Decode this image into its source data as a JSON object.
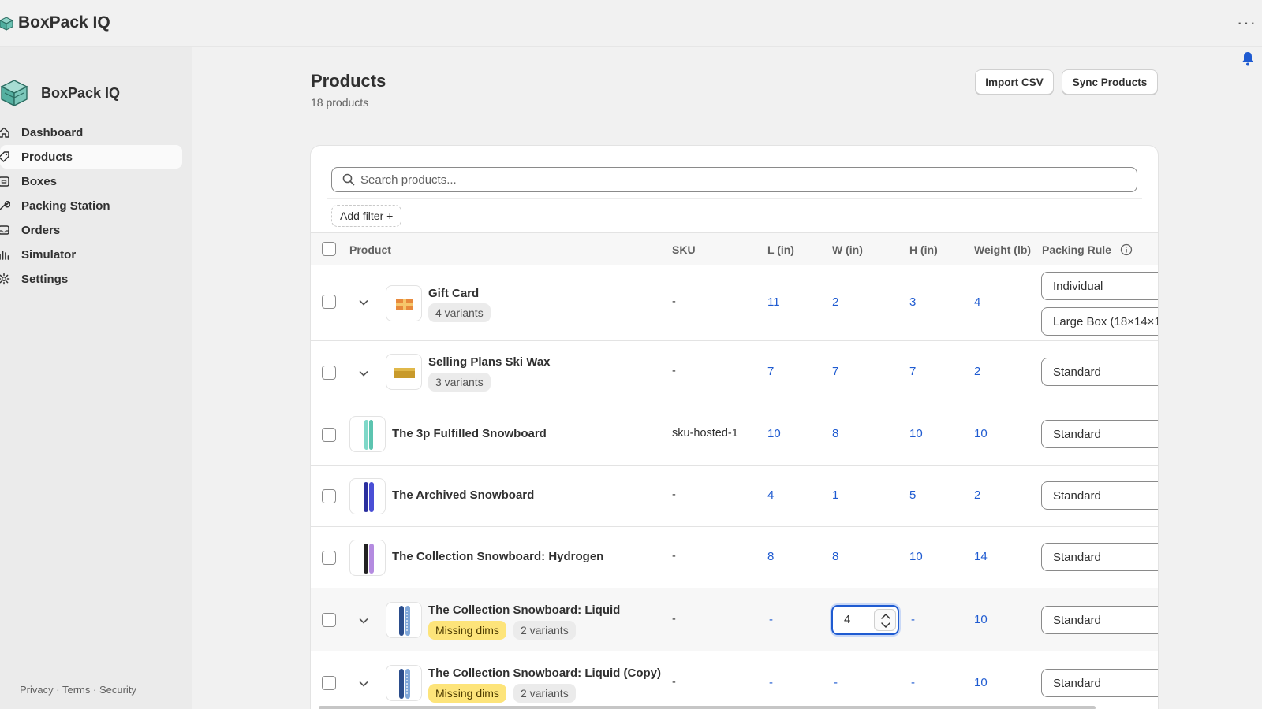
{
  "app": {
    "title": "BoxPack IQ"
  },
  "sidebar": {
    "brand": "BoxPack IQ",
    "items": [
      {
        "label": "Dashboard",
        "icon": "home-icon"
      },
      {
        "label": "Products",
        "icon": "tag-icon"
      },
      {
        "label": "Boxes",
        "icon": "box-icon"
      },
      {
        "label": "Packing Station",
        "icon": "wrench-icon"
      },
      {
        "label": "Orders",
        "icon": "inbox-icon"
      },
      {
        "label": "Simulator",
        "icon": "bar-chart-icon"
      },
      {
        "label": "Settings",
        "icon": "gear-icon"
      }
    ],
    "active": "Products",
    "footer": {
      "privacy": "Privacy",
      "terms": "Terms",
      "security": "Security",
      "sep": "·"
    }
  },
  "page": {
    "title": "Products",
    "subtitle": "18 products",
    "import_label": "Import CSV",
    "sync_label": "Sync Products"
  },
  "search": {
    "placeholder": "Search products..."
  },
  "filter": {
    "label": "Add filter +"
  },
  "table": {
    "headers": {
      "product": "Product",
      "sku": "SKU",
      "l": "L (in)",
      "w": "W (in)",
      "h": "H (in)",
      "weight": "Weight (lb)",
      "rule": "Packing Rule"
    },
    "rows": [
      {
        "name": "Gift Card",
        "variants": "4 variants",
        "missing": "",
        "sku": "-",
        "l": "11",
        "w": "2",
        "h": "3",
        "weight": "4",
        "rule": "Individual",
        "rule2": "Large Box (18×14×1"
      },
      {
        "name": "Selling Plans Ski Wax",
        "variants": "3 variants",
        "missing": "",
        "sku": "-",
        "l": "7",
        "w": "7",
        "h": "7",
        "weight": "2",
        "rule": "Standard"
      },
      {
        "name": "The 3p Fulfilled Snowboard",
        "variants": "",
        "missing": "",
        "sku": "sku-hosted-1",
        "l": "10",
        "w": "8",
        "h": "10",
        "weight": "10",
        "rule": "Standard"
      },
      {
        "name": "The Archived Snowboard",
        "variants": "",
        "missing": "",
        "sku": "-",
        "l": "4",
        "w": "1",
        "h": "5",
        "weight": "2",
        "rule": "Standard"
      },
      {
        "name": "The Collection Snowboard: Hydrogen",
        "variants": "",
        "missing": "",
        "sku": "-",
        "l": "8",
        "w": "8",
        "h": "10",
        "weight": "14",
        "rule": "Standard"
      },
      {
        "name": "The Collection Snowboard: Liquid",
        "variants": "2 variants",
        "missing": "Missing dims",
        "sku": "-",
        "l": "-",
        "w": "4",
        "h": "-",
        "weight": "10",
        "rule": "Standard"
      },
      {
        "name": "The Collection Snowboard: Liquid (Copy)",
        "variants": "2 variants",
        "missing": "Missing dims",
        "sku": "-",
        "l": "-",
        "w": "-",
        "h": "-",
        "weight": "10",
        "rule": "Standard"
      }
    ]
  },
  "colors": {
    "accent": "#1f5bd1",
    "badge_yellow": "#fde47a"
  }
}
